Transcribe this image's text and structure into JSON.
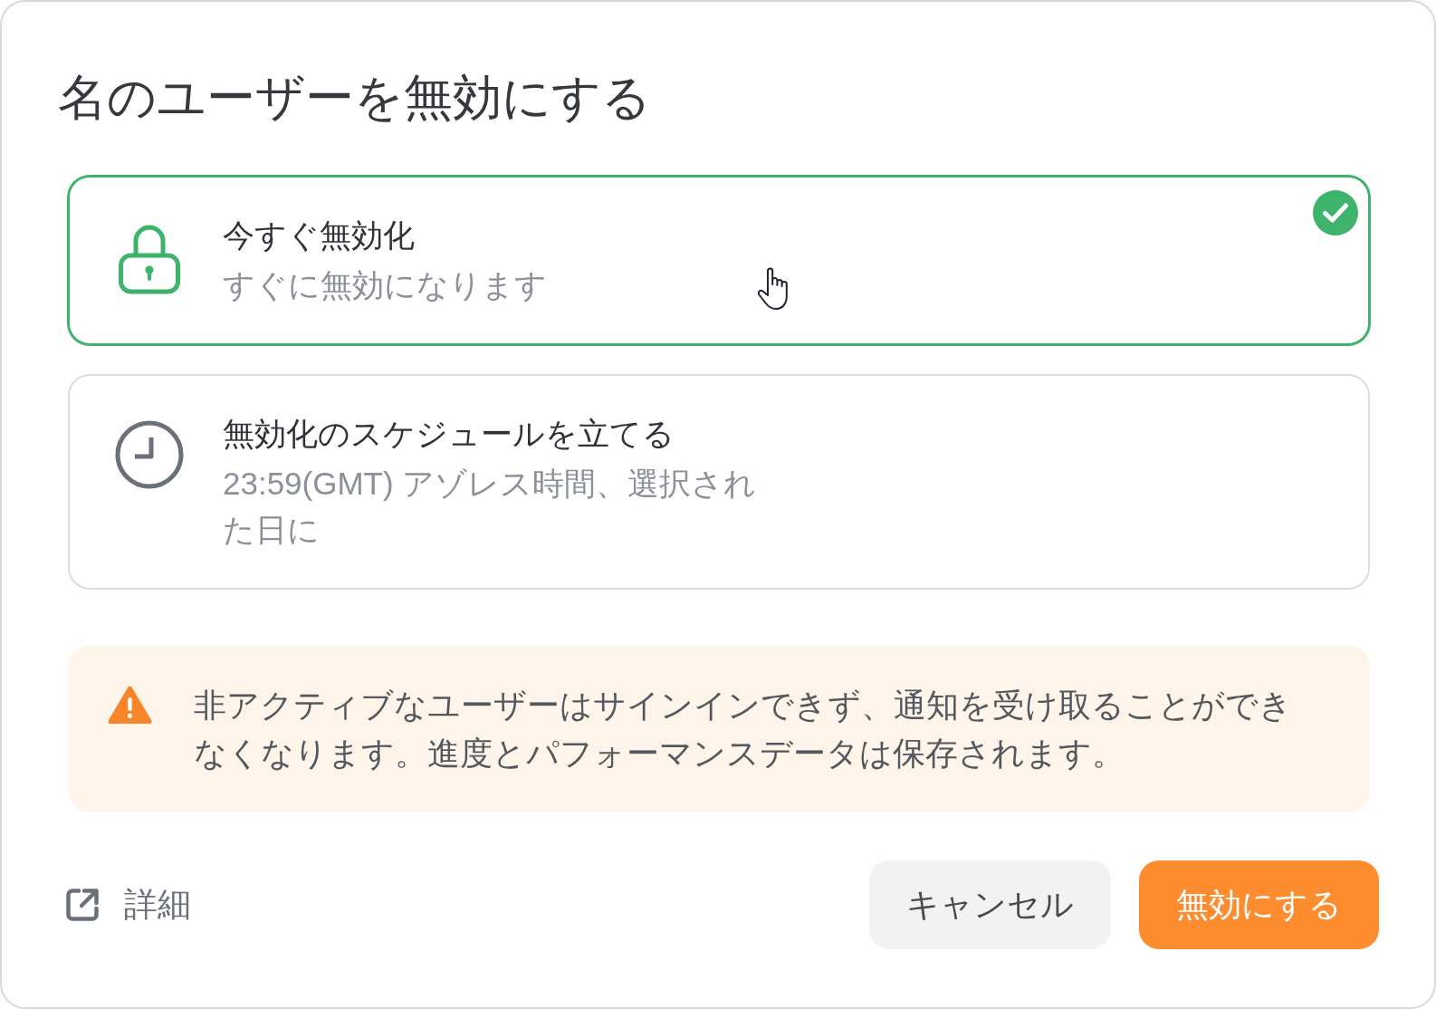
{
  "dialog": {
    "title": "名のユーザーを無効にする"
  },
  "options": [
    {
      "kind": "lock",
      "title": "今すぐ無効化",
      "description": "すぐに無効になります",
      "selected": true
    },
    {
      "kind": "clock",
      "title": "無効化のスケジュールを立てる",
      "description": "23:59(GMT) アゾレス時間、選択された日に",
      "selected": false
    }
  ],
  "warning": {
    "text": "非アクティブなユーザーはサインインできず、通知を受け取ることができなくなります。進度とパフォーマンスデータは保存されます。"
  },
  "footer": {
    "link": "詳細",
    "buttons": [
      {
        "kind": "secondary",
        "label": "キャンセル"
      },
      {
        "kind": "primary",
        "label": "無効にする"
      }
    ]
  }
}
